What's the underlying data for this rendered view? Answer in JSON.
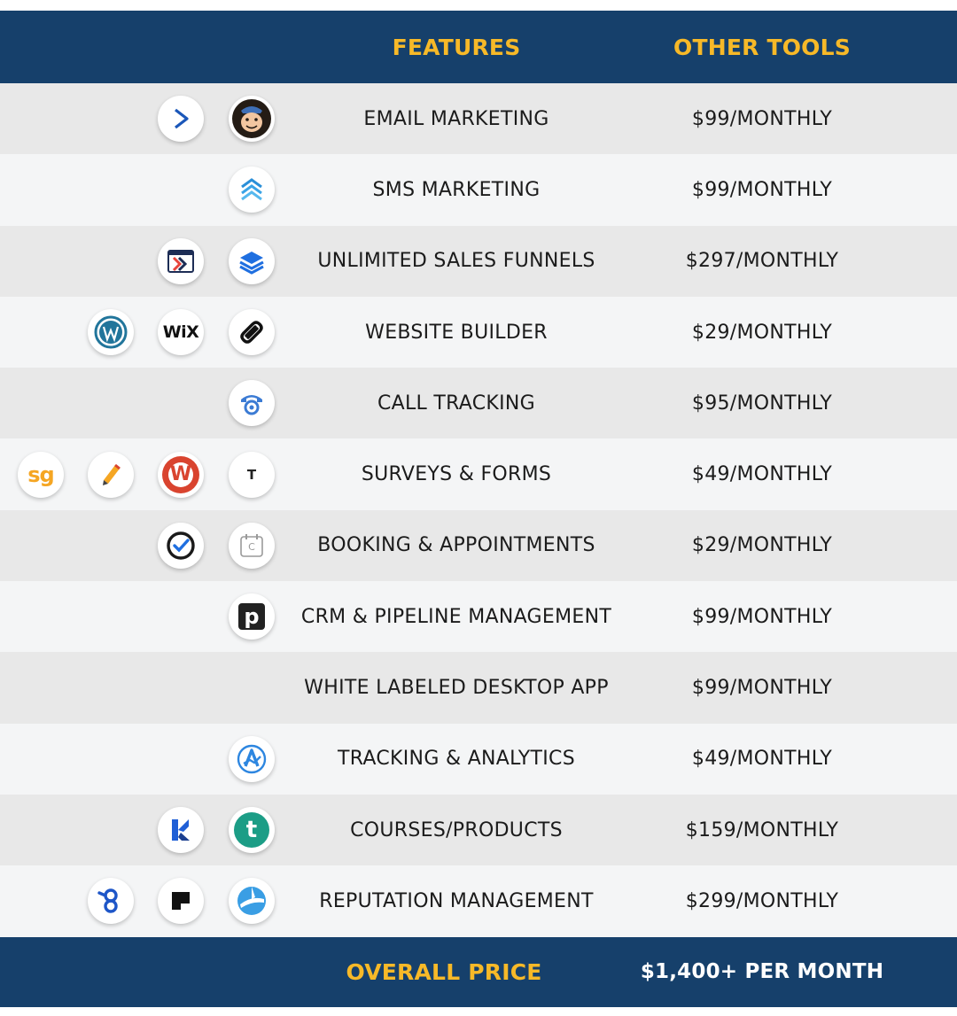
{
  "header": {
    "features_label": "FEATURES",
    "other_tools_label": "OTHER TOOLS"
  },
  "rows": [
    {
      "feature": "EMAIL MARKETING",
      "price": "$99/MONTHLY",
      "icons": [
        "mailchimp-icon",
        "activecampaign-icon"
      ]
    },
    {
      "feature": "SMS MARKETING",
      "price": "$99/MONTHLY",
      "icons": [
        "sms-chevrons-icon"
      ]
    },
    {
      "feature": "UNLIMITED SALES FUNNELS",
      "price": "$297/MONTHLY",
      "icons": [
        "layers-icon",
        "clickfunnels-icon"
      ]
    },
    {
      "feature": "WEBSITE BUILDER",
      "price": "$29/MONTHLY",
      "icons": [
        "squarespace-icon",
        "wix-icon",
        "wordpress-icon"
      ]
    },
    {
      "feature": "CALL TRACKING",
      "price": "$95/MONTHLY",
      "icons": [
        "call-tracking-icon"
      ]
    },
    {
      "feature": "SURVEYS & FORMS",
      "price": "$49/MONTHLY",
      "icons": [
        "typeform-icon",
        "wufoo-icon",
        "jotform-icon",
        "surveygizmo-icon"
      ]
    },
    {
      "feature": "BOOKING & APPOINTMENTS",
      "price": "$29/MONTHLY",
      "icons": [
        "calendly-icon",
        "acuity-icon"
      ]
    },
    {
      "feature": "CRM & PIPELINE MANAGEMENT",
      "price": "$99/MONTHLY",
      "icons": [
        "pipedrive-icon"
      ]
    },
    {
      "feature": "WHITE LABELED DESKTOP APP",
      "price": "$99/MONTHLY",
      "icons": []
    },
    {
      "feature": "TRACKING & ANALYTICS",
      "price": "$49/MONTHLY",
      "icons": [
        "analytics-icon"
      ]
    },
    {
      "feature": "COURSES/PRODUCTS",
      "price": "$159/MONTHLY",
      "icons": [
        "teachable-icon",
        "kajabi-icon"
      ]
    },
    {
      "feature": "REPUTATION MANAGEMENT",
      "price": "$299/MONTHLY",
      "icons": [
        "swipe-icon",
        "podium-icon",
        "birdeye-icon"
      ]
    }
  ],
  "footer": {
    "overall_label": "OVERALL PRICE",
    "overall_price": "$1,400+ PER MONTH"
  },
  "icon_text": {
    "wix": "WiX",
    "surveygizmo": "sg",
    "typeform": "T",
    "wufoo": "W",
    "pipedrive": "p",
    "teachable": "t",
    "acuity": "C"
  },
  "colors": {
    "header_bg": "#16406b",
    "header_text": "#f7b928",
    "row_odd": "#e8e8e8",
    "row_even": "#f4f5f6",
    "text": "#1b1b1b"
  }
}
